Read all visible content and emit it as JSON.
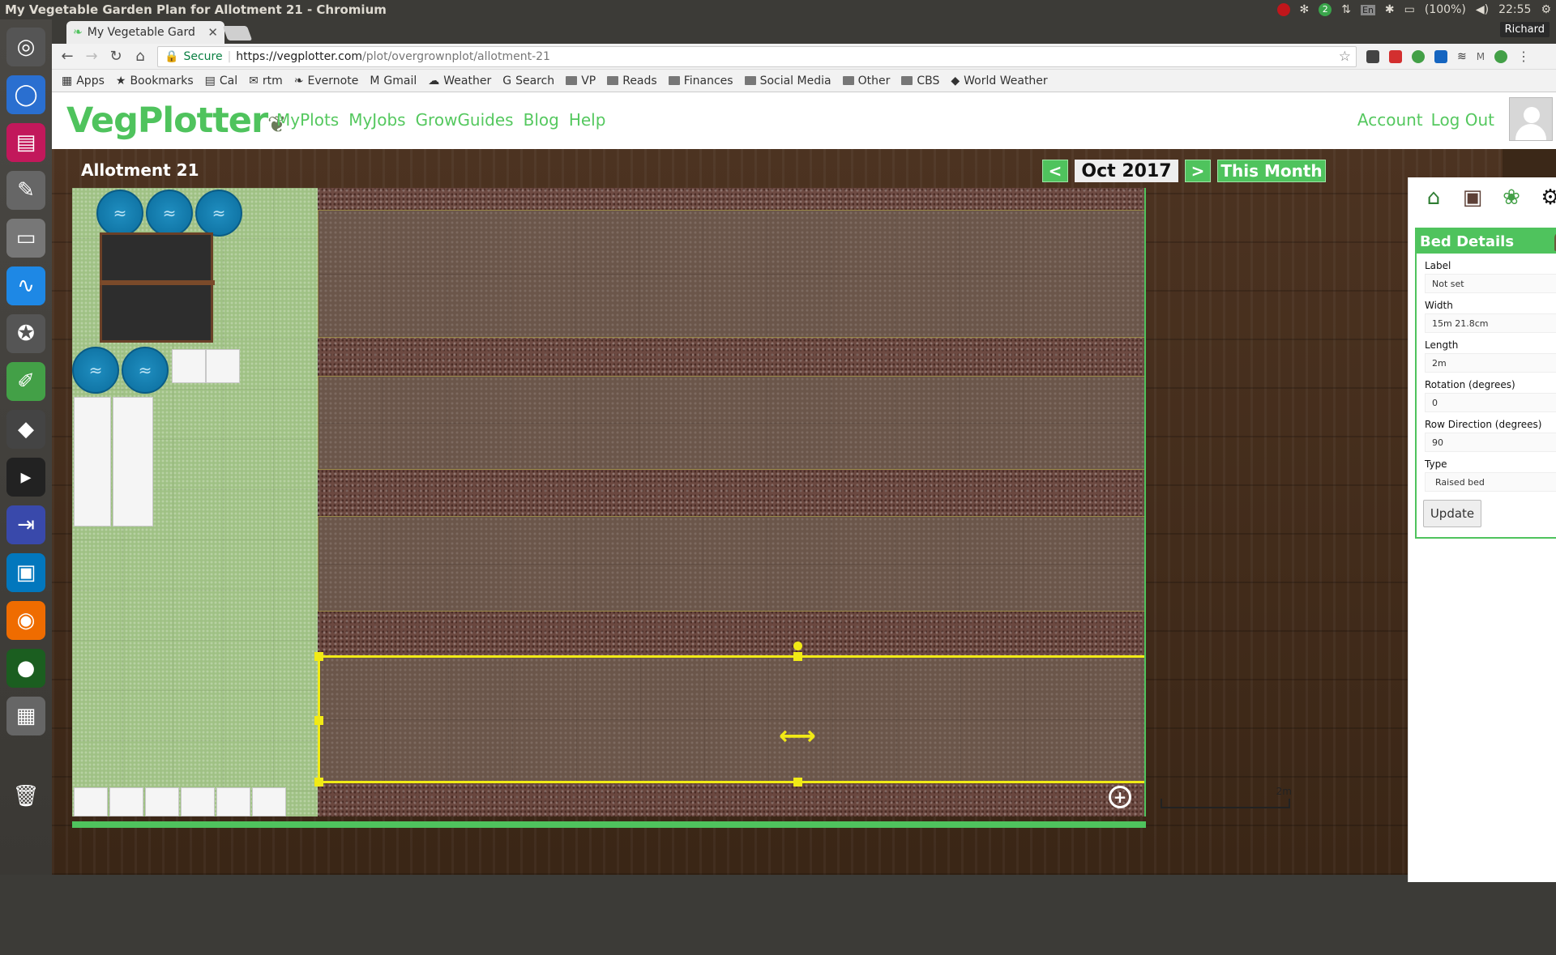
{
  "os": {
    "window_title": "My Vegetable Garden Plan for Allotment 21 - Chromium",
    "clock": "22:55",
    "battery": "(100%)",
    "user": "Richard",
    "keyboard": "En",
    "notify_count": "2"
  },
  "browser": {
    "tab_title": "My Vegetable Gard",
    "secure_label": "Secure",
    "url_host": "https://vegplotter.com",
    "url_path": "/plot/overgrownplot/allotment-21",
    "ext_mail_badge": "M",
    "bookmarks": [
      {
        "label": "Apps",
        "icon": "apps-grid-icon"
      },
      {
        "label": "Bookmarks",
        "icon": "star-icon"
      },
      {
        "label": "Cal",
        "icon": "calendar-icon"
      },
      {
        "label": "rtm",
        "icon": "rtm-icon"
      },
      {
        "label": "Evernote",
        "icon": "evernote-icon"
      },
      {
        "label": "Gmail",
        "icon": "gmail-icon"
      },
      {
        "label": "Weather",
        "icon": "weather-icon"
      },
      {
        "label": "Search",
        "icon": "google-icon"
      },
      {
        "label": "VP",
        "icon": "folder-icon"
      },
      {
        "label": "Reads",
        "icon": "folder-icon"
      },
      {
        "label": "Finances",
        "icon": "folder-icon"
      },
      {
        "label": "Social Media",
        "icon": "folder-icon"
      },
      {
        "label": "Other",
        "icon": "folder-icon"
      },
      {
        "label": "CBS",
        "icon": "folder-icon"
      },
      {
        "label": "World Weather",
        "icon": "world-weather-icon"
      }
    ]
  },
  "site": {
    "logo": "VegPlotter",
    "nav": [
      "MyPlots",
      "MyJobs",
      "GrowGuides",
      "Blog",
      "Help"
    ],
    "account": "Account",
    "logout": "Log Out",
    "accent": "#4fc35d"
  },
  "plot": {
    "name": "Allotment 21",
    "prev": "<",
    "next": ">",
    "month": "Oct 2017",
    "this_month": "This Month",
    "scale_label": "2m",
    "move_glyph": "⟷"
  },
  "bed_details": {
    "title": "Bed Details",
    "label_lbl": "Label",
    "label_val": "Not set",
    "width_lbl": "Width",
    "width_val": "15m 21.8cm",
    "length_lbl": "Length",
    "length_val": "2m",
    "rotation_lbl": "Rotation (degrees)",
    "rotation_val": "0",
    "rowdir_lbl": "Row Direction (degrees)",
    "rowdir_val": "90",
    "type_lbl": "Type",
    "type_val": "Raised bed",
    "update": "Update"
  }
}
